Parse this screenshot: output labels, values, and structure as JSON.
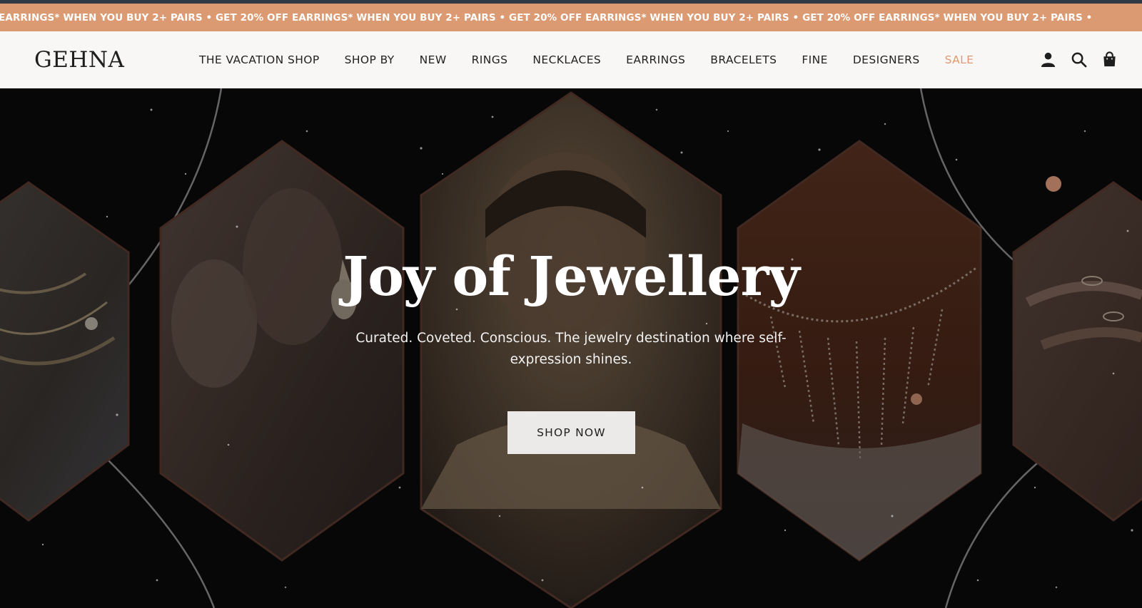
{
  "announcement": {
    "text": "EARRINGS* WHEN YOU BUY 2+ PAIRS • GET 20% OFF EARRINGS* WHEN YOU BUY 2+ PAIRS • GET 20% OFF EARRINGS* WHEN YOU BUY 2+ PAIRS • GET 20% OFF EARRINGS* WHEN YOU BUY 2+ PAIRS •"
  },
  "header": {
    "logo": "GEHNA",
    "nav": [
      {
        "label": "THE VACATION SHOP"
      },
      {
        "label": "SHOP BY"
      },
      {
        "label": "NEW"
      },
      {
        "label": "RINGS"
      },
      {
        "label": "NECKLACES"
      },
      {
        "label": "EARRINGS"
      },
      {
        "label": "BRACELETS"
      },
      {
        "label": "FINE"
      },
      {
        "label": "DESIGNERS"
      },
      {
        "label": "SALE"
      }
    ],
    "icons": [
      "account-icon",
      "search-icon",
      "cart-icon"
    ]
  },
  "hero": {
    "title": "Joy of Jewellery",
    "subtitle": "Curated. Coveted. Conscious. The jewelry destination where self-expression shines.",
    "cta_label": "SHOP NOW",
    "images": [
      "bracelets-image",
      "earring-image",
      "model-image",
      "necklace-image",
      "rings-image"
    ]
  },
  "colors": {
    "announcement_bg": "#db9a72",
    "header_bg": "#f8f7f5",
    "sale_accent": "#e09a72",
    "hero_bg": "#0b0b0c",
    "cta_bg": "#eceae8"
  }
}
